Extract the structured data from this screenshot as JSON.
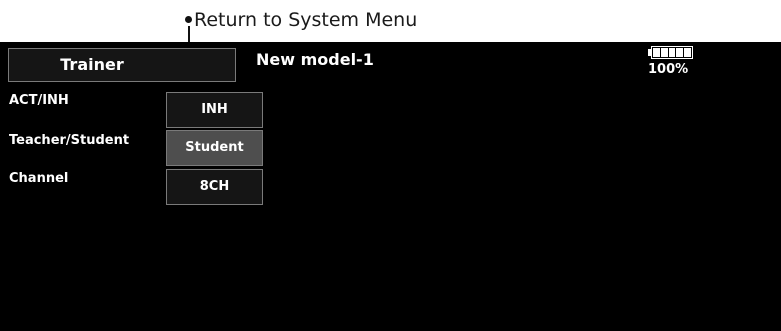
{
  "annotation": {
    "text": "Return to System Menu"
  },
  "header": {
    "title_button_label": "Trainer",
    "model_name": "New model-1",
    "battery": {
      "icon": "battery-icon",
      "level_fraction": 1.0,
      "percent_label": "100%"
    }
  },
  "settings": {
    "rows": [
      {
        "label": "ACT/INH",
        "value": "INH",
        "selected": false
      },
      {
        "label": "Teacher/Student",
        "value": "Student",
        "selected": true
      },
      {
        "label": "Channel",
        "value": "8CH",
        "selected": false
      }
    ]
  },
  "colors": {
    "screen_background": "#000000",
    "button_background": "#151515",
    "selected_button_background": "#4e4e4e",
    "button_border": "#7a7a7a",
    "text": "#ffffff"
  }
}
